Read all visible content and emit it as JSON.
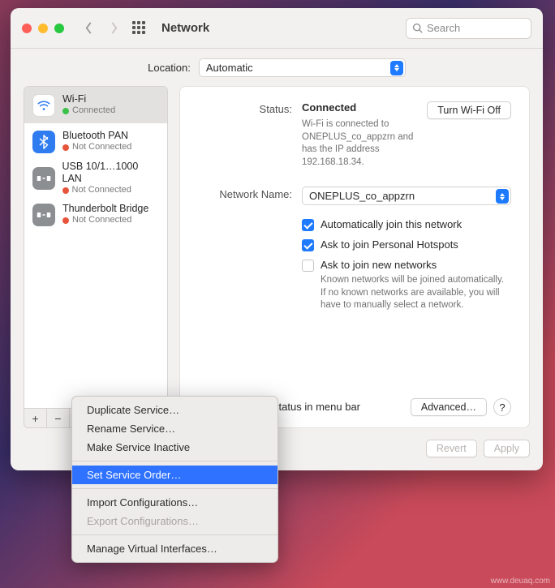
{
  "header": {
    "title": "Network",
    "search_placeholder": "Search"
  },
  "location": {
    "label": "Location:",
    "value": "Automatic"
  },
  "sidebar": {
    "items": [
      {
        "name": "Wi-Fi",
        "status": "Connected",
        "dot": "green"
      },
      {
        "name": "Bluetooth PAN",
        "status": "Not Connected",
        "dot": "red"
      },
      {
        "name": "USB 10/1…1000 LAN",
        "status": "Not Connected",
        "dot": "red"
      },
      {
        "name": "Thunderbolt Bridge",
        "status": "Not Connected",
        "dot": "red"
      }
    ],
    "tools": {
      "add": "+",
      "remove": "−"
    }
  },
  "main": {
    "status_label": "Status:",
    "status_value": "Connected",
    "wifi_off_btn": "Turn Wi-Fi Off",
    "status_detail": "Wi-Fi is connected to ONEPLUS_co_appzrn and has the IP address 192.168.18.34.",
    "netname_label": "Network Name:",
    "netname_value": "ONEPLUS_co_appzrn",
    "auto_join": "Automatically join this network",
    "ask_hotspots": "Ask to join Personal Hotspots",
    "ask_new": "Ask to join new networks",
    "ask_new_detail": "Known networks will be joined automatically. If no known networks are available, you will have to manually select a network.",
    "show_menubar": "Show Wi-Fi status in menu bar",
    "advanced_btn": "Advanced…",
    "help": "?"
  },
  "footer": {
    "revert": "Revert",
    "apply": "Apply"
  },
  "menu": {
    "duplicate": "Duplicate Service…",
    "rename": "Rename Service…",
    "inactive": "Make Service Inactive",
    "set_order": "Set Service Order…",
    "import": "Import Configurations…",
    "export": "Export Configurations…",
    "manage": "Manage Virtual Interfaces…"
  },
  "watermark": "www.deuaq.com"
}
